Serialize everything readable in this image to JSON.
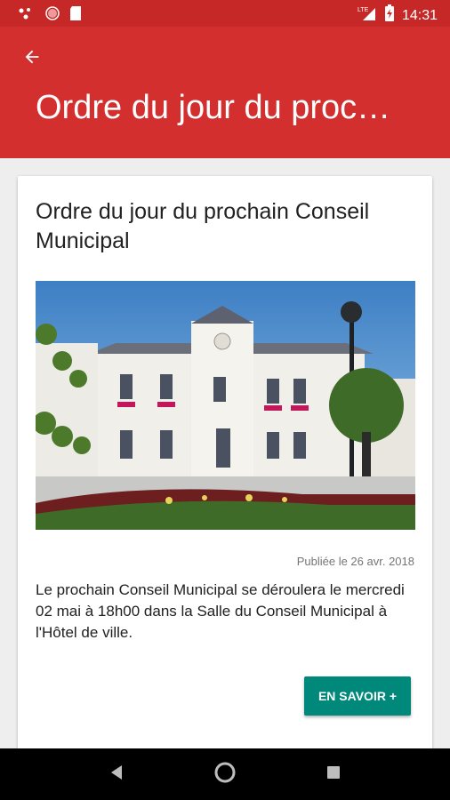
{
  "status_bar": {
    "time": "14:31",
    "network": "LTE",
    "icons": [
      "notification-dots-icon",
      "record-icon",
      "sd-card-icon",
      "signal-icon",
      "battery-icon"
    ]
  },
  "app_bar": {
    "title": "Ordre du jour du proc…",
    "back_icon": "arrow-back-icon"
  },
  "article": {
    "title": "Ordre du jour du prochain Conseil Municipal",
    "published": "Publiée le 26 avr. 2018",
    "body": "Le prochain Conseil Municipal se déroulera le mercredi 02 mai à 18h00 dans la Salle du Conseil Municipal à l'Hôtel de ville.",
    "cta_label": "EN SAVOIR +"
  },
  "nav_bar": {
    "back": "nav-back-icon",
    "home": "nav-home-icon",
    "recents": "nav-recents-icon"
  },
  "colors": {
    "app_bar": "#d32f2f",
    "status_bar": "#c62828",
    "accent": "#00897b"
  }
}
